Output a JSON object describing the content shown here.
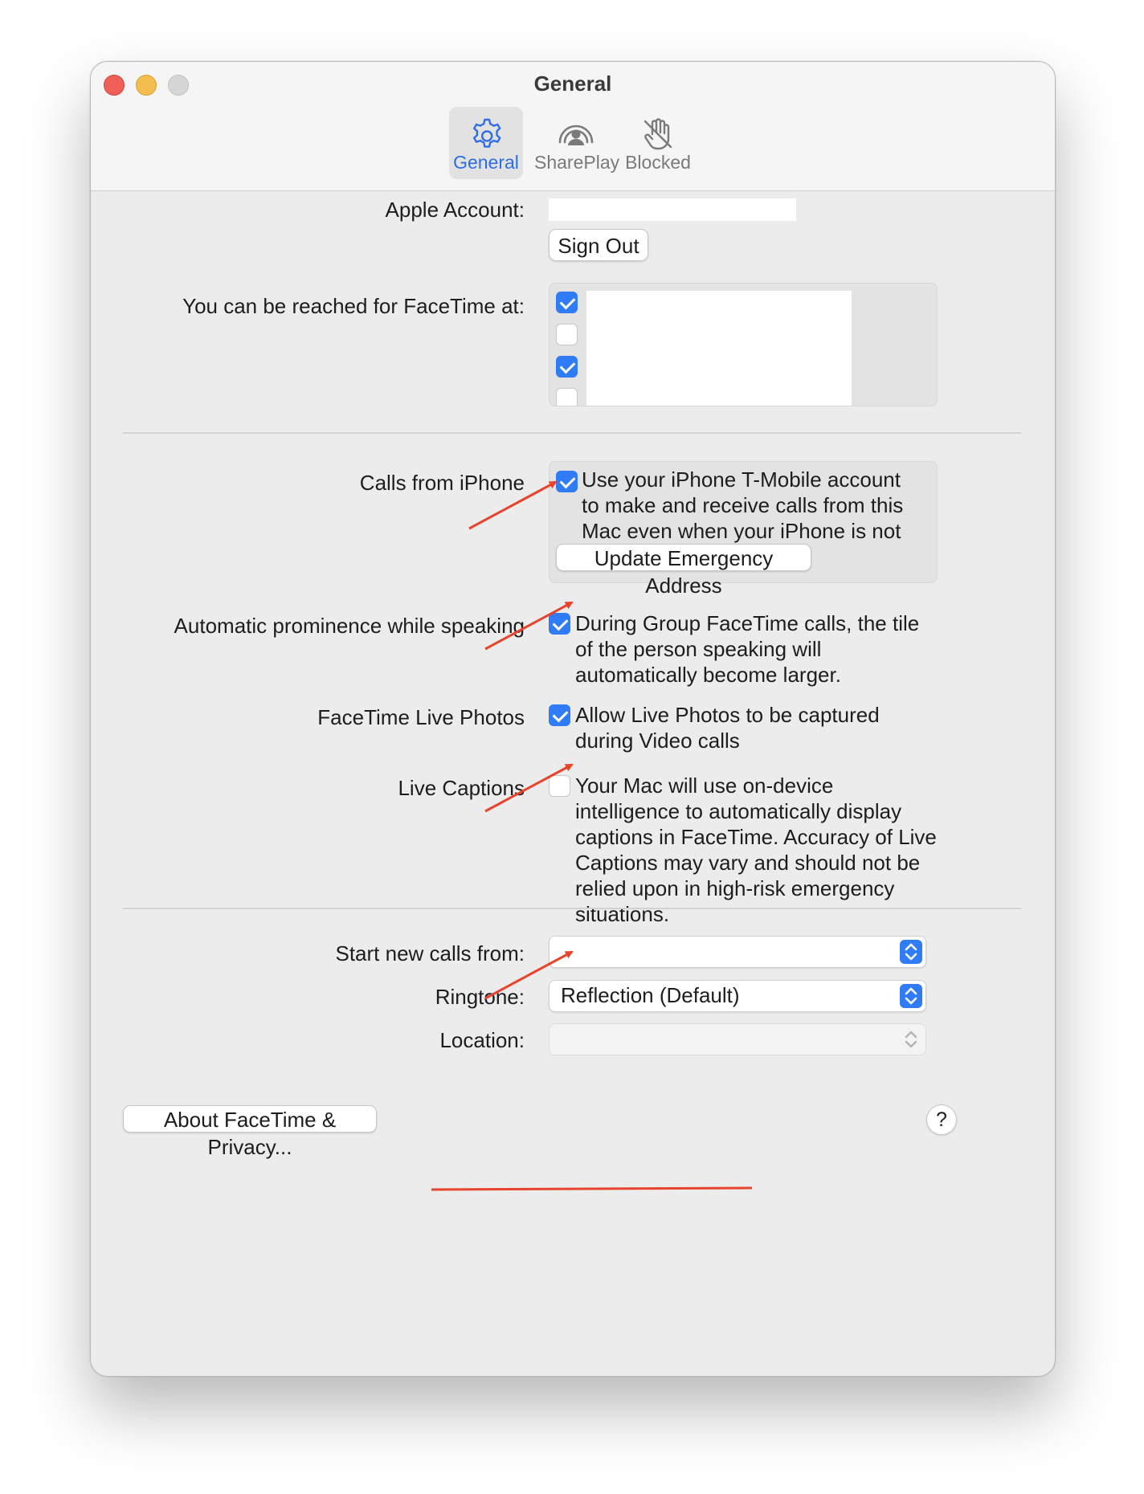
{
  "window": {
    "title": "General"
  },
  "toolbar": {
    "tabs": [
      {
        "label": "General",
        "icon": "gear-icon",
        "selected": true
      },
      {
        "label": "SharePlay",
        "icon": "shareplay-icon",
        "selected": false
      },
      {
        "label": "Blocked",
        "icon": "raised-hand-icon",
        "selected": false
      }
    ]
  },
  "account": {
    "label": "Apple Account:",
    "sign_out_label": "Sign Out"
  },
  "reach": {
    "label": "You can be reached for FaceTime at:",
    "checkboxes": [
      true,
      false,
      true,
      false
    ]
  },
  "calls_from_iphone": {
    "label": "Calls from iPhone",
    "checked": true,
    "description": "Use your iPhone T-Mobile account to make and receive calls from this Mac even when your iPhone is not nearby.",
    "update_button": "Update Emergency Address"
  },
  "auto_prominence": {
    "label": "Automatic prominence while speaking",
    "checked": true,
    "description": "During Group FaceTime calls, the tile of the person speaking will automatically become larger."
  },
  "live_photos": {
    "label": "FaceTime Live Photos",
    "checked": true,
    "description": "Allow Live Photos to be captured during Video calls"
  },
  "live_captions": {
    "label": "Live Captions",
    "checked": false,
    "description": "Your Mac will use on-device intelligence to automatically display captions in FaceTime. Accuracy of Live Captions may vary and should not be relied upon in high-risk emergency situations."
  },
  "start_calls": {
    "label": "Start new calls from:",
    "value": ""
  },
  "ringtone": {
    "label": "Ringtone:",
    "value": "Reflection (Default)"
  },
  "location": {
    "label": "Location:",
    "value": ""
  },
  "footer": {
    "about_label": "About FaceTime & Privacy...",
    "help_label": "?"
  },
  "colors": {
    "accent": "#2f7cf6",
    "annotation": "#e8432c",
    "close": "#ee5f57",
    "minimize": "#f4be4f"
  }
}
